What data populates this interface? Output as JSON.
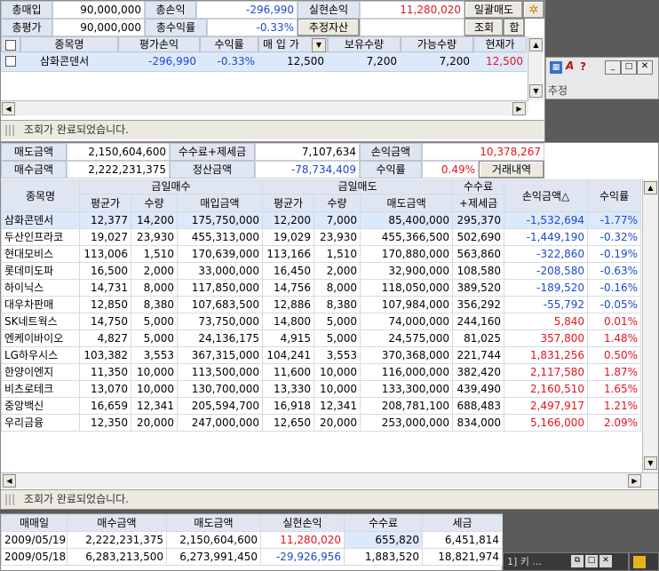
{
  "top_panel": {
    "total_buy_label": "총매입",
    "total_buy_value": "90,000,000",
    "total_pl_label": "총손익",
    "total_pl_value": "-296,990",
    "realized_label": "실현손익",
    "realized_value": "11,280,020",
    "bulk_sell_label": "일괄매도",
    "total_eval_label": "총평가",
    "total_eval_value": "90,000,000",
    "total_rate_label": "총수익률",
    "total_rate_value": "-0.33%",
    "estimate_button": "추정자산",
    "query_button": "조회",
    "sum_button": "합",
    "columns": [
      "종목명",
      "평가손익",
      "수익률",
      "매 입 가",
      "보유수량",
      "가능수량",
      "현재가"
    ],
    "rows": [
      [
        "삼화콘덴서",
        "-296,990",
        "-0.33%",
        "12,500",
        "7,200",
        "7,200",
        "12,500"
      ]
    ],
    "status": "조회가 완료되었습니다."
  },
  "right_strip": {
    "tab_fragment": "추정"
  },
  "summary": {
    "sell_amt_label": "매도금액",
    "sell_amt_value": "2,150,604,600",
    "fee_tax_label": "수수료+제세금",
    "fee_tax_value": "7,107,634",
    "pl_amt_label": "손익금액",
    "pl_amt_value": "10,378,267",
    "buy_amt_label": "매수금액",
    "buy_amt_value": "2,222,231,375",
    "settle_label": "정산금액",
    "settle_value": "-78,734,409",
    "rate_label": "수익률",
    "rate_value": "0.49%",
    "trade_button": "거래내역"
  },
  "main_table": {
    "h_name": "종목명",
    "h_buy_group": "금일매수",
    "h_sell_group": "금일매도",
    "h_fee": "수수료",
    "h_fee2": "+제세금",
    "h_pl": "손익금액△",
    "h_rate": "수익률",
    "h_buy_avg": "평균가",
    "h_buy_qty": "수량",
    "h_buy_amt": "매입금액",
    "h_sell_avg": "평균가",
    "h_sell_qty": "수량",
    "h_sell_amt": "매도금액",
    "rows": [
      [
        "삼화콘덴서",
        "12,377",
        "14,200",
        "175,750,000",
        "12,200",
        "7,000",
        "85,400,000",
        "295,370",
        "-1,532,694",
        "-1.77%"
      ],
      [
        "두산인프라코",
        "19,027",
        "23,930",
        "455,313,000",
        "19,029",
        "23,930",
        "455,366,500",
        "502,690",
        "-1,449,190",
        "-0.32%"
      ],
      [
        "현대모비스",
        "113,006",
        "1,510",
        "170,639,000",
        "113,166",
        "1,510",
        "170,880,000",
        "563,860",
        "-322,860",
        "-0.19%"
      ],
      [
        "롯데미도파",
        "16,500",
        "2,000",
        "33,000,000",
        "16,450",
        "2,000",
        "32,900,000",
        "108,580",
        "-208,580",
        "-0.63%"
      ],
      [
        "하이닉스",
        "14,731",
        "8,000",
        "117,850,000",
        "14,756",
        "8,000",
        "118,050,000",
        "389,520",
        "-189,520",
        "-0.16%"
      ],
      [
        "대우차판매",
        "12,850",
        "8,380",
        "107,683,500",
        "12,886",
        "8,380",
        "107,984,000",
        "356,292",
        "-55,792",
        "-0.05%"
      ],
      [
        "SK네트웍스",
        "14,750",
        "5,000",
        "73,750,000",
        "14,800",
        "5,000",
        "74,000,000",
        "244,160",
        "5,840",
        "0.01%"
      ],
      [
        "엔케이바이오",
        "4,827",
        "5,000",
        "24,136,175",
        "4,915",
        "5,000",
        "24,575,000",
        "81,025",
        "357,800",
        "1.48%"
      ],
      [
        "LG하우시스",
        "103,382",
        "3,553",
        "367,315,000",
        "104,241",
        "3,553",
        "370,368,000",
        "221,744",
        "1,831,256",
        "0.50%"
      ],
      [
        "한양이엔지",
        "11,350",
        "10,000",
        "113,500,000",
        "11,600",
        "10,000",
        "116,000,000",
        "382,420",
        "2,117,580",
        "1.87%"
      ],
      [
        "비츠로테크",
        "13,070",
        "10,000",
        "130,700,000",
        "13,330",
        "10,000",
        "133,300,000",
        "439,490",
        "2,160,510",
        "1.65%"
      ],
      [
        "중앙백신",
        "16,659",
        "12,341",
        "205,594,700",
        "16,918",
        "12,341",
        "208,781,100",
        "688,483",
        "2,497,917",
        "1.21%"
      ],
      [
        "우리금융",
        "12,350",
        "20,000",
        "247,000,000",
        "12,650",
        "20,000",
        "253,000,000",
        "834,000",
        "5,166,000",
        "2.09%"
      ]
    ],
    "status": "조회가 완료되었습니다."
  },
  "daily_table": {
    "columns": [
      "매매일",
      "매수금액",
      "매도금액",
      "실현손익",
      "수수료",
      "세금"
    ],
    "rows": [
      [
        "2009/05/19",
        "2,222,231,375",
        "2,150,604,600",
        "11,280,020",
        "655,820",
        "6,451,814"
      ],
      [
        "2009/05/18",
        "6,283,213,500",
        "6,273,991,450",
        "-29,926,956",
        "1,883,520",
        "18,821,974"
      ]
    ]
  },
  "taskbar": {
    "item_fragment": "1] 키 ..."
  },
  "colors": {
    "header_bg": "#dfe6f1",
    "selected_row": "#dbe9fb",
    "positive": "#e0141e",
    "negative": "#1d49c8"
  }
}
